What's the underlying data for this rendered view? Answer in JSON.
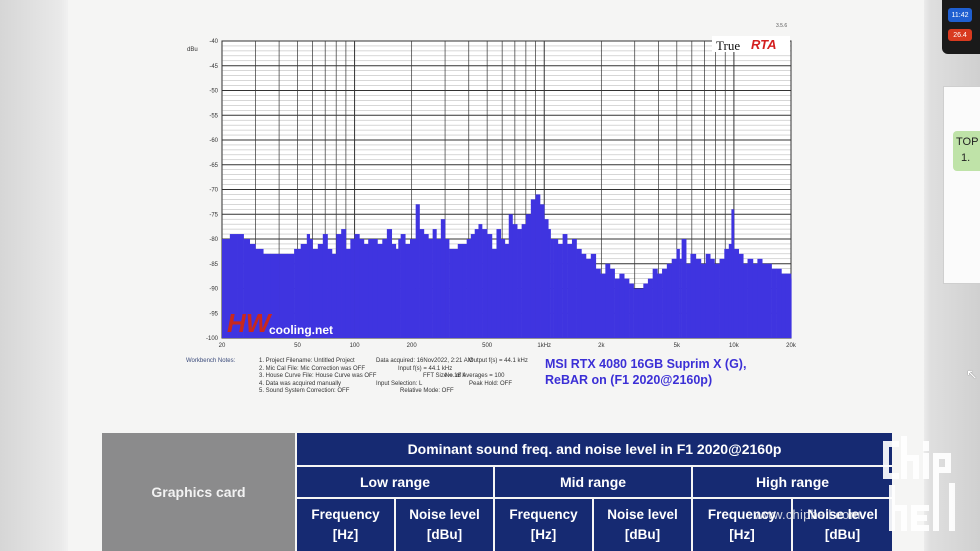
{
  "chart_data": {
    "type": "area",
    "app": "TrueRTA",
    "brand": {
      "true": "True",
      "rta": "RTA"
    },
    "version": "3.5.6",
    "ylabel": "dBu",
    "ylim": [
      -100,
      -40
    ],
    "y_ticks": [
      "-40",
      "-45",
      "-50",
      "-55",
      "-60",
      "-65",
      "-70",
      "-75",
      "-80",
      "-85",
      "-90",
      "-95",
      "-100"
    ],
    "x_scale": "log",
    "xlim": [
      20,
      20000
    ],
    "x_ticks": [
      {
        "v": 20,
        "label": "20"
      },
      {
        "v": 50,
        "label": "50"
      },
      {
        "v": 100,
        "label": "100"
      },
      {
        "v": 200,
        "label": "200"
      },
      {
        "v": 500,
        "label": "500"
      },
      {
        "v": 1000,
        "label": "1kHz"
      },
      {
        "v": 2000,
        "label": "2k"
      },
      {
        "v": 5000,
        "label": "5k"
      },
      {
        "v": 10000,
        "label": "10k"
      },
      {
        "v": 20000,
        "label": "20k"
      }
    ],
    "grid": true,
    "bar_color": "#3f34e0",
    "x": [
      20,
      22,
      24,
      26,
      28,
      30,
      33,
      36,
      40,
      44,
      48,
      52,
      56,
      58,
      60,
      64,
      68,
      72,
      76,
      80,
      85,
      90,
      95,
      100,
      106,
      112,
      118,
      125,
      132,
      140,
      148,
      157,
      165,
      170,
      175,
      185,
      196,
      210,
      220,
      232,
      245,
      258,
      270,
      285,
      300,
      315,
      330,
      350,
      370,
      390,
      410,
      430,
      450,
      470,
      500,
      530,
      560,
      590,
      620,
      650,
      680,
      720,
      760,
      800,
      850,
      900,
      950,
      1000,
      1050,
      1080,
      1120,
      1180,
      1250,
      1320,
      1400,
      1480,
      1570,
      1660,
      1760,
      1870,
      1980,
      2100,
      2220,
      2350,
      2490,
      2640,
      2800,
      2960,
      3140,
      3330,
      3520,
      3730,
      3950,
      4180,
      4430,
      4700,
      4980,
      5170,
      5300,
      5600,
      5900,
      6300,
      6700,
      7100,
      7500,
      7900,
      8400,
      8900,
      9400,
      9700,
      10000,
      10600,
      11200,
      11800,
      12600,
      13300,
      14100,
      15000,
      15800,
      16800,
      17800,
      18800,
      20000
    ],
    "y": [
      -80,
      -79,
      -79,
      -80,
      -81,
      -82,
      -83,
      -83,
      -83,
      -83,
      -82,
      -81,
      -79,
      -80,
      -82,
      -81,
      -79,
      -82,
      -83,
      -79,
      -78,
      -82,
      -80,
      -79,
      -80,
      -81,
      -80,
      -80,
      -81,
      -80,
      -78,
      -81,
      -82,
      -80,
      -79,
      -81,
      -80,
      -73,
      -78,
      -79,
      -80,
      -78,
      -80,
      -76,
      -80,
      -82,
      -82,
      -81,
      -81,
      -80,
      -79,
      -78,
      -77,
      -78,
      -79,
      -82,
      -78,
      -80,
      -81,
      -75,
      -77,
      -78,
      -77,
      -75,
      -72,
      -71,
      -73,
      -76,
      -78,
      -80,
      -80,
      -81,
      -79,
      -81,
      -80,
      -82,
      -83,
      -84,
      -83,
      -86,
      -87,
      -85,
      -86,
      -88,
      -87,
      -88,
      -89,
      -90,
      -90,
      -89,
      -88,
      -86,
      -87,
      -86,
      -85,
      -84,
      -82,
      -84,
      -80,
      -85,
      -83,
      -84,
      -85,
      -83,
      -84,
      -85,
      -84,
      -82,
      -81,
      -74,
      -82,
      -83,
      -85,
      -84,
      -85,
      -84,
      -85,
      -85,
      -86,
      -86,
      -87,
      -87,
      -88
    ]
  },
  "watermark_logo": {
    "hw": "HW",
    "text": "cooling.net"
  },
  "notes": {
    "label": "Workbench Notes:",
    "col1": [
      "1. Project Filename: Untitled Project",
      "2. Mic Cal File: Mic Correction was OFF",
      "3. House Curve File: House Curve was OFF",
      "4. Data was acquired manually",
      "5. Sound System Correction: OFF"
    ],
    "col2": [
      "Data acquired: 16Nov2022, 2:21 AM",
      "Input f(s) = 44.1 kHz",
      "FFT Size = 16 k",
      "Input Selection: L",
      "Relative Mode: OFF"
    ],
    "col3": [
      "",
      "Output f(s) = 44.1 kHz",
      "",
      "No. of Averages = 100",
      "Peak Hold: OFF"
    ]
  },
  "caption": {
    "line1": "MSI RTX 4080 16GB Suprim X (G),",
    "line2": "ReBAR on (F1 2020@2160p)"
  },
  "table": {
    "graphics_card_header": "Graphics card",
    "title": "Dominant sound freq. and noise level in F1 2020@2160p",
    "ranges": [
      "Low range",
      "Mid range",
      "High range"
    ],
    "sub_headers": [
      {
        "l1": "Frequency",
        "l2": "[Hz]"
      },
      {
        "l1": "Noise level",
        "l2": "[dBu]"
      },
      {
        "l1": "Frequency",
        "l2": "[Hz]"
      },
      {
        "l1": "Noise level",
        "l2": "[dBu]"
      },
      {
        "l1": "Frequency",
        "l2": "[Hz]"
      },
      {
        "l1": "Noise level",
        "l2": "[dBu]"
      }
    ]
  },
  "side": {
    "top_badge_l1": "TOP",
    "top_badge_l2": "1.",
    "w_blue": "11:42",
    "w_red": "26.4"
  },
  "watermark": {
    "url": "www.chiphell.com"
  },
  "colors": {
    "table_header_bg": "#162a72",
    "graphics_card_bg": "#8b8b8c",
    "caption": "#3b2fd6",
    "rta_red": "#d42020"
  }
}
